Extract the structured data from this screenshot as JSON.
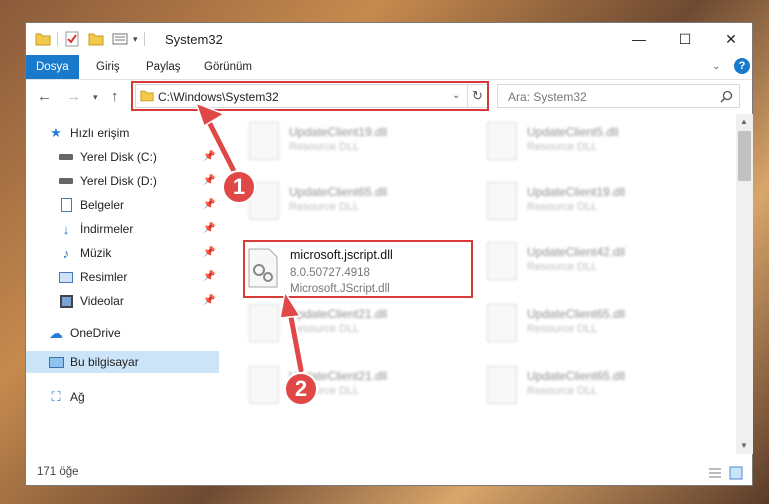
{
  "window": {
    "title": "System32",
    "controls": {
      "minimize": "—",
      "maximize": "☐",
      "close": "✕"
    }
  },
  "ribbon": {
    "tabs": [
      {
        "label": "Dosya",
        "active": true
      },
      {
        "label": "Giriş"
      },
      {
        "label": "Paylaş"
      },
      {
        "label": "Görünüm"
      }
    ],
    "help": "?"
  },
  "navigation": {
    "address": "C:\\Windows\\System32",
    "search_placeholder": "Ara: System32"
  },
  "sidebar": {
    "items": [
      {
        "label": "Hızlı erişim",
        "icon": "star-icon"
      },
      {
        "label": "Yerel Disk (C:)",
        "icon": "drive-icon",
        "pinned": true
      },
      {
        "label": "Yerel Disk (D:)",
        "icon": "drive-icon",
        "pinned": true
      },
      {
        "label": "Belgeler",
        "icon": "document-icon",
        "pinned": true
      },
      {
        "label": "İndirmeler",
        "icon": "download-icon",
        "pinned": true
      },
      {
        "label": "Müzik",
        "icon": "music-icon",
        "pinned": true
      },
      {
        "label": "Resimler",
        "icon": "picture-icon",
        "pinned": true
      },
      {
        "label": "Videolar",
        "icon": "video-icon",
        "pinned": true
      },
      {
        "label": "OneDrive",
        "icon": "cloud-icon"
      },
      {
        "label": "Bu bilgisayar",
        "icon": "computer-icon",
        "selected": true
      },
      {
        "label": "Ağ",
        "icon": "network-icon"
      }
    ]
  },
  "files": {
    "left": [
      {
        "name": "UpdateClient19.dll",
        "type": "Resource DLL"
      },
      {
        "name": "UpdateClient65.dll",
        "type": "Resource DLL"
      },
      {
        "name": "UpdateClient21.dll",
        "type": "Resource DLL"
      },
      {
        "name": "UpdateClient21.dll",
        "type": "Resource DLL"
      }
    ],
    "right": [
      {
        "name": "UpdateClient5.dll",
        "type": "Resource DLL"
      },
      {
        "name": "UpdateClient19.dll",
        "type": "Resource DLL"
      },
      {
        "name": "UpdateClient42.dll",
        "type": "Resource DLL"
      },
      {
        "name": "UpdateClient65.dll",
        "type": "Resource DLL"
      },
      {
        "name": "UpdateClient65.dll",
        "type": "Resource DLL"
      }
    ],
    "highlighted": {
      "name": "microsoft.jscript.dll",
      "version": "8.0.50727.4918",
      "description": "Microsoft.JScript.dll"
    }
  },
  "status": {
    "item_count": "171 öğe"
  },
  "annotations": {
    "step1": "1",
    "step2": "2"
  },
  "colors": {
    "accent": "#1979ca",
    "highlight": "#d83a3a",
    "selection": "#cce4f7"
  }
}
